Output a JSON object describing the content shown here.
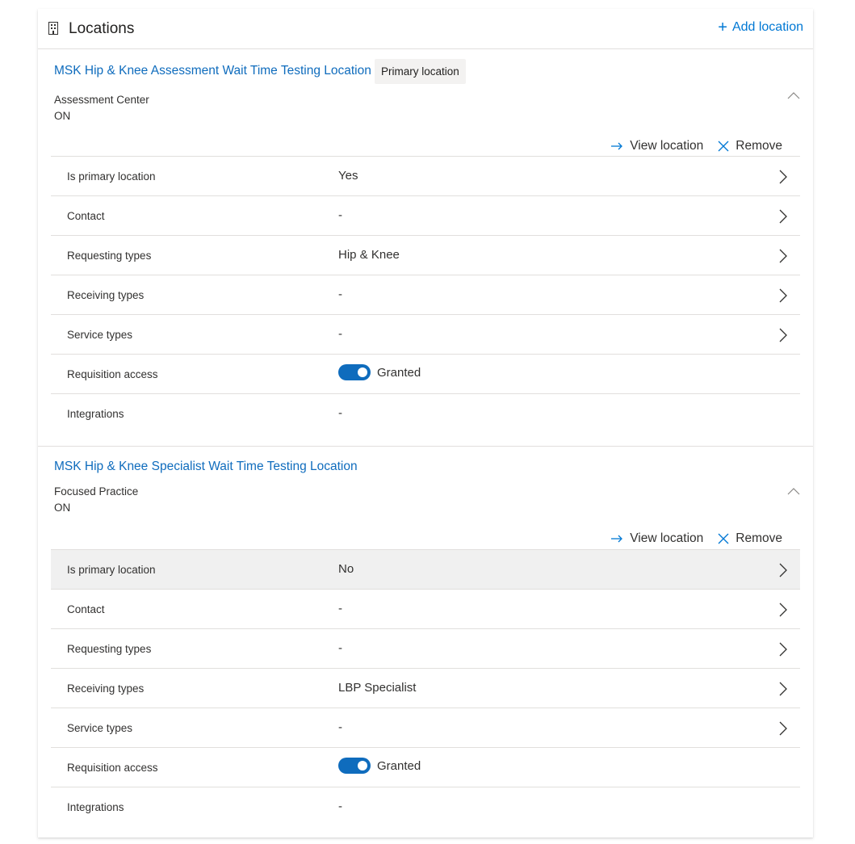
{
  "header": {
    "title": "Locations",
    "add_label": "Add location"
  },
  "locations": [
    {
      "name": "MSK Hip & Knee Assessment Wait Time Testing Location",
      "badge": "Primary location",
      "type": "Assessment Center",
      "province": "ON",
      "view_label": "View location",
      "remove_label": "Remove",
      "rows": [
        {
          "label": "Is primary location",
          "value": "Yes"
        },
        {
          "label": "Contact",
          "value": "-"
        },
        {
          "label": "Requesting types",
          "value": "Hip & Knee"
        },
        {
          "label": "Receiving types",
          "value": "-"
        },
        {
          "label": "Service types",
          "value": "-"
        },
        {
          "label": "Requisition access",
          "value": "Granted",
          "toggle_on": true
        },
        {
          "label": "Integrations",
          "value": "-"
        }
      ]
    },
    {
      "name": "MSK Hip & Knee Specialist Wait Time Testing Location",
      "type": "Focused Practice",
      "province": "ON",
      "view_label": "View location",
      "remove_label": "Remove",
      "rows": [
        {
          "label": "Is primary location",
          "value": "No"
        },
        {
          "label": "Contact",
          "value": "-"
        },
        {
          "label": "Requesting types",
          "value": "-"
        },
        {
          "label": "Receiving types",
          "value": "LBP Specialist"
        },
        {
          "label": "Service types",
          "value": "-"
        },
        {
          "label": "Requisition access",
          "value": "Granted",
          "toggle_on": true
        },
        {
          "label": "Integrations",
          "value": "-"
        }
      ]
    }
  ],
  "colors": {
    "accent": "#0078d4",
    "link": "#0f6cbd",
    "toggle": "#0f6cbd",
    "hover_row": "#f0f0f0"
  }
}
